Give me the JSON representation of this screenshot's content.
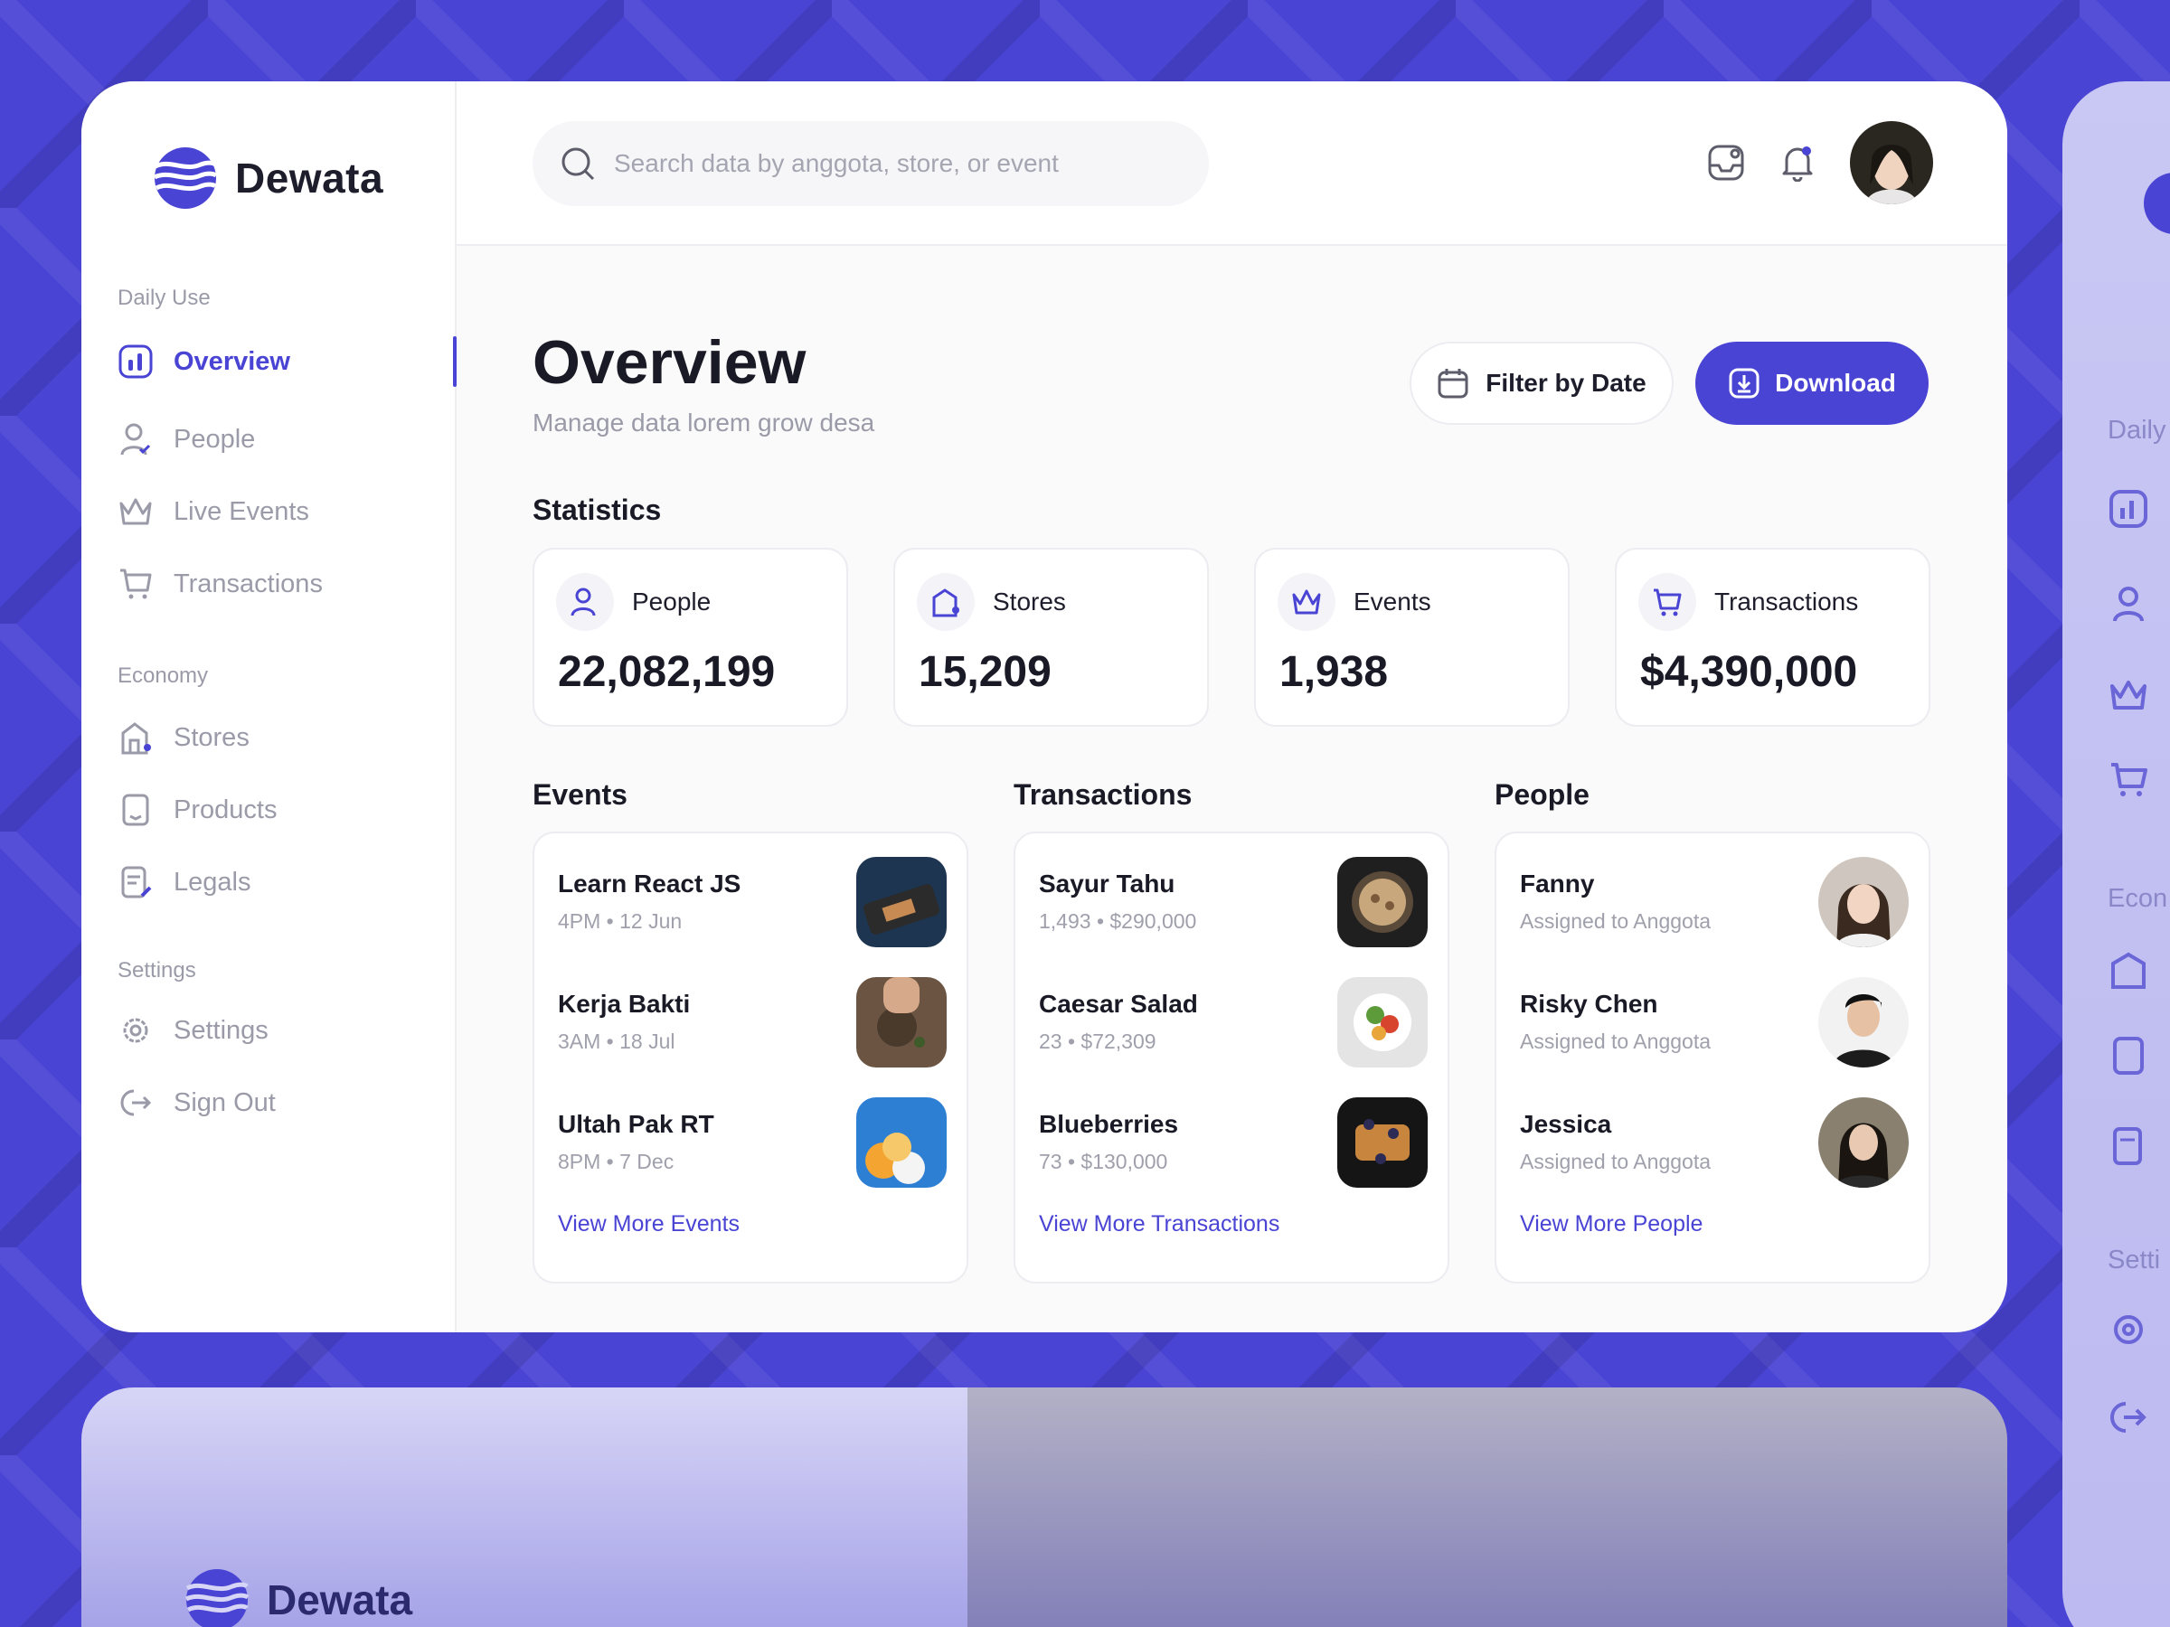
{
  "brand": {
    "name": "Dewata"
  },
  "search": {
    "placeholder": "Search data by anggota, store, or event"
  },
  "sidebar": {
    "groups": [
      {
        "label": "Daily Use"
      },
      {
        "label": "Economy"
      },
      {
        "label": "Settings"
      }
    ],
    "items": [
      {
        "label": "Overview",
        "icon": "chart-icon",
        "active": true
      },
      {
        "label": "People",
        "icon": "user-icon"
      },
      {
        "label": "Live Events",
        "icon": "crown-icon"
      },
      {
        "label": "Transactions",
        "icon": "cart-icon"
      },
      {
        "label": "Stores",
        "icon": "store-icon"
      },
      {
        "label": "Products",
        "icon": "receipt-icon"
      },
      {
        "label": "Legals",
        "icon": "document-icon"
      },
      {
        "label": "Settings",
        "icon": "gear-icon"
      },
      {
        "label": "Sign Out",
        "icon": "sign-out-icon"
      }
    ]
  },
  "header": {
    "title": "Overview",
    "subtitle": "Manage data lorem grow desa",
    "filter_label": "Filter by Date",
    "download_label": "Download"
  },
  "statistics": {
    "title": "Statistics",
    "cards": [
      {
        "label": "People",
        "value": "22,082,199",
        "icon": "user-icon"
      },
      {
        "label": "Stores",
        "value": "15,209",
        "icon": "store-icon"
      },
      {
        "label": "Events",
        "value": "1,938",
        "icon": "crown-icon"
      },
      {
        "label": "Transactions",
        "value": "$4,390,000",
        "icon": "cart-icon"
      }
    ]
  },
  "events": {
    "title": "Events",
    "items": [
      {
        "title": "Learn React JS",
        "meta": "4PM • 12 Jun"
      },
      {
        "title": "Kerja Bakti",
        "meta": "3AM • 18 Jul"
      },
      {
        "title": "Ultah Pak RT",
        "meta": "8PM • 7 Dec"
      }
    ],
    "view_more": "View More Events"
  },
  "transactions": {
    "title": "Transactions",
    "items": [
      {
        "title": "Sayur Tahu",
        "meta": "1,493 • $290,000"
      },
      {
        "title": "Caesar Salad",
        "meta": "23 • $72,309"
      },
      {
        "title": "Blueberries",
        "meta": "73 • $130,000"
      }
    ],
    "view_more": "View More Transactions"
  },
  "people": {
    "title": "People",
    "items": [
      {
        "title": "Fanny",
        "meta": "Assigned to Anggota"
      },
      {
        "title": "Risky Chen",
        "meta": "Assigned to Anggota"
      },
      {
        "title": "Jessica",
        "meta": "Assigned to Anggota"
      }
    ],
    "view_more": "View More People"
  },
  "right_preview": {
    "labels": [
      "Daily",
      "Econ",
      "Setti"
    ]
  },
  "colors": {
    "accent": "#4a44d4",
    "background": "#4b45d6"
  }
}
